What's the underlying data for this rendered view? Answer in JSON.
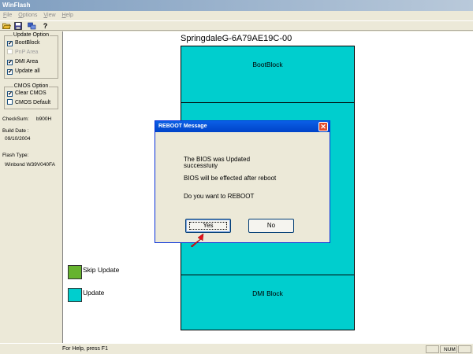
{
  "window": {
    "title": "WinFlash"
  },
  "menu": [
    {
      "label": "File",
      "mnemonic": "F",
      "rest": "ile"
    },
    {
      "label": "Options",
      "mnemonic": "O",
      "rest": "ptions"
    },
    {
      "label": "View",
      "mnemonic": "V",
      "rest": "iew"
    },
    {
      "label": "Help",
      "mnemonic": "H",
      "rest": "elp"
    }
  ],
  "toolbar": {
    "icons": [
      "open-folder-icon",
      "save-icon",
      "flash-icon",
      "help-icon"
    ],
    "help_glyph": "?"
  },
  "update_option": {
    "title": "Update Option",
    "items": [
      {
        "label": "BootBlock",
        "checked": true,
        "enabled": true
      },
      {
        "label": "PnP Area",
        "checked": false,
        "enabled": false
      },
      {
        "label": "DMI Area",
        "checked": true,
        "enabled": true
      },
      {
        "label": "Update all",
        "checked": true,
        "enabled": true
      }
    ]
  },
  "cmos_option": {
    "title": "CMOS Option",
    "items": [
      {
        "label": "Clear CMOS",
        "checked": true,
        "enabled": true
      },
      {
        "label": "CMOS Default",
        "checked": false,
        "enabled": true
      }
    ]
  },
  "info": {
    "checksum_label": "CheckSum:",
    "checksum_value": "b900H",
    "build_date_label": "Build Date :",
    "build_date_value": "09/10/2004",
    "flash_type_label": "Flash Type:",
    "flash_type_value": "Winbond W39V040FA"
  },
  "main": {
    "chip_title": "SpringdaleG-6A79AE19C-00",
    "blocks": [
      {
        "label": "BootBlock"
      },
      {
        "label": ""
      },
      {
        "label": "DMI Block"
      }
    ],
    "legend": [
      {
        "label": "Skip Update",
        "color": "#66b32e"
      },
      {
        "label": "Update",
        "color": "#00cece"
      }
    ]
  },
  "dialog": {
    "title": "REBOOT Message",
    "close_glyph": "✕",
    "line1": "The BIOS was Updated",
    "line1_cont": "successfully",
    "line2": "BIOS will be effected after reboot",
    "line3": "Do you want to REBOOT",
    "yes_label": "Yes",
    "no_label": "No"
  },
  "status": {
    "text": "For Help, press F1",
    "num_indicator": "NUM"
  },
  "colors": {
    "update": "#00cece",
    "skip": "#66b32e",
    "pointer": "#e8101a"
  }
}
